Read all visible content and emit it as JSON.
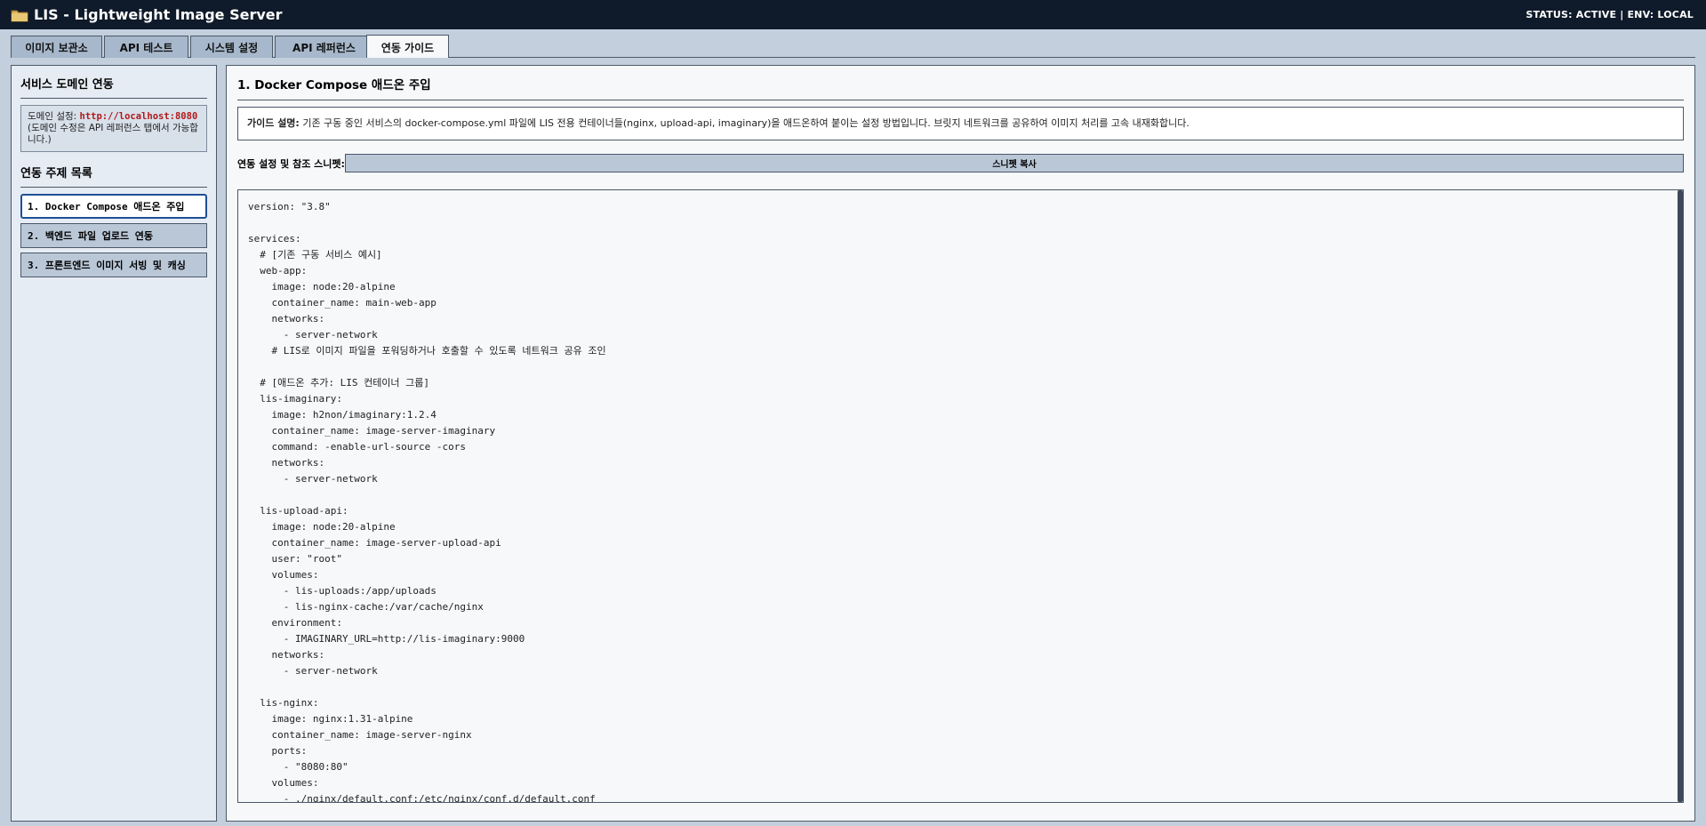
{
  "app": {
    "title": "LIS - Lightweight Image Server",
    "status": "STATUS: ACTIVE | ENV: LOCAL",
    "icon": "folder-icon"
  },
  "tabs": [
    {
      "label": "이미지 보관소"
    },
    {
      "label": "API 테스트"
    },
    {
      "label": "시스템 설정"
    },
    {
      "label": "API 레퍼런스"
    },
    {
      "label": "연동 가이드",
      "active": true
    }
  ],
  "sidebar": {
    "domain_title": "서비스 도메인 연동",
    "domain_label": "도메인 설정: ",
    "domain_url": "http://localhost:8080",
    "domain_note": "(도메인 수정은 API 레퍼런스 탭에서 가능합니다.)",
    "topics_title": "연동 주제 목록",
    "topics": [
      {
        "label": "1. Docker Compose 애드온 주입",
        "active": true
      },
      {
        "label": "2. 백엔드 파일 업로드 연동"
      },
      {
        "label": "3. 프론트엔드 이미지 서빙 및 캐싱"
      }
    ]
  },
  "main": {
    "title": "1. Docker Compose 애드온 주입",
    "guide_label": "가이드 설명:",
    "guide_text": " 기존 구동 중인 서비스의 docker-compose.yml 파일에 LIS 전용 컨테이너들(nginx, upload-api, imaginary)을 애드온하여 붙이는 설정 방법입니다. 브릿지 네트워크를 공유하여 이미지 처리를 고속 내재화합니다.",
    "snippet_label": "연동 설정 및 참조 스니펫:",
    "copy_label": "스니펫 복사",
    "code": "version: \"3.8\"\n\nservices:\n  # [기존 구동 서비스 예시]\n  web-app:\n    image: node:20-alpine\n    container_name: main-web-app\n    networks:\n      - server-network\n    # LIS로 이미지 파일을 포워딩하거나 호출할 수 있도록 네트워크 공유 조인\n\n  # [애드온 추가: LIS 컨테이너 그룹]\n  lis-imaginary:\n    image: h2non/imaginary:1.2.4\n    container_name: image-server-imaginary\n    command: -enable-url-source -cors\n    networks:\n      - server-network\n\n  lis-upload-api:\n    image: node:20-alpine\n    container_name: image-server-upload-api\n    user: \"root\"\n    volumes:\n      - lis-uploads:/app/uploads\n      - lis-nginx-cache:/var/cache/nginx\n    environment:\n      - IMAGINARY_URL=http://lis-imaginary:9000\n    networks:\n      - server-network\n\n  lis-nginx:\n    image: nginx:1.31-alpine\n    container_name: image-server-nginx\n    ports:\n      - \"8080:80\"\n    volumes:\n      - ./nginx/default.conf:/etc/nginx/conf.d/default.conf"
  }
}
